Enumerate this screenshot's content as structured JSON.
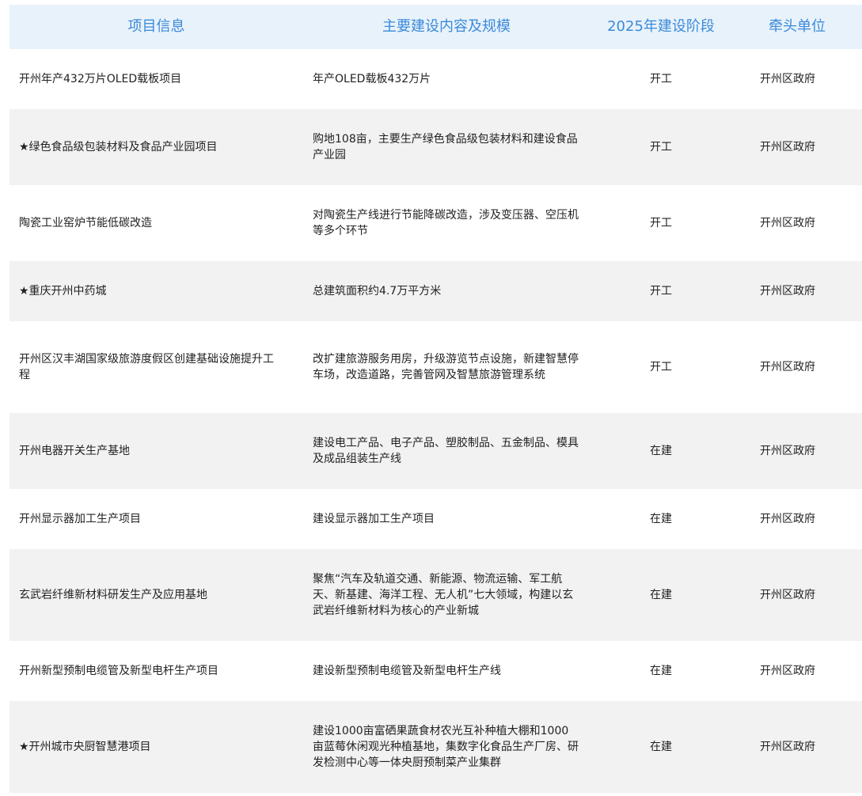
{
  "headers": [
    "项目信息",
    "主要建设内容及规模",
    "2025年建设阶段",
    "牵头单位"
  ],
  "rows": [
    {
      "name": "开州年产432万片OLED载板项目",
      "content": "年产OLED载板432万片",
      "stage": "开工",
      "unit": "开州区政府"
    },
    {
      "name": "★绿色食品级包装材料及食品产业园项目",
      "content": "购地108亩，主要生产绿色食品级包装材料和建设食品产业园",
      "stage": "开工",
      "unit": "开州区政府"
    },
    {
      "name": "陶瓷工业窑炉节能低碳改造",
      "content": "对陶瓷生产线进行节能降碳改造，涉及变压器、空压机等多个环节",
      "stage": "开工",
      "unit": "开州区政府"
    },
    {
      "name": "★重庆开州中药城",
      "content": "总建筑面积约4.7万平方米",
      "stage": "开工",
      "unit": "开州区政府"
    },
    {
      "name": "开州区汉丰湖国家级旅游度假区创建基础设施提升工程",
      "content": "改扩建旅游服务用房，升级游览节点设施，新建智慧停车场，改造道路，完善管网及智慧旅游管理系统",
      "stage": "开工",
      "unit": "开州区政府"
    },
    {
      "name": "开州电器开关生产基地",
      "content": "建设电工产品、电子产品、塑胶制品、五金制品、模具及成品组装生产线",
      "stage": "在建",
      "unit": "开州区政府"
    },
    {
      "name": "开州显示器加工生产项目",
      "content": "建设显示器加工生产项目",
      "stage": "在建",
      "unit": "开州区政府"
    },
    {
      "name": "玄武岩纤维新材料研发生产及应用基地",
      "content": "聚焦“汽车及轨道交通、新能源、物流运输、军工航天、新基建、海洋工程、无人机”七大领域，构建以玄武岩纤维新材料为核心的产业新城",
      "stage": "在建",
      "unit": "开州区政府"
    },
    {
      "name": "开州新型预制电缆管及新型电杆生产项目",
      "content": "建设新型预制电缆管及新型电杆生产线",
      "stage": "在建",
      "unit": "开州区政府"
    },
    {
      "name": "★开州城市央厨智慧港项目",
      "content": "建设1000亩富硒果蔬食材农光互补种植大棚和1000亩蓝莓休闲观光种植基地，集数字化食品生产厂房、研发检测中心等一体央厨预制菜产业集群",
      "stage": "在建",
      "unit": "开州区政府"
    }
  ]
}
